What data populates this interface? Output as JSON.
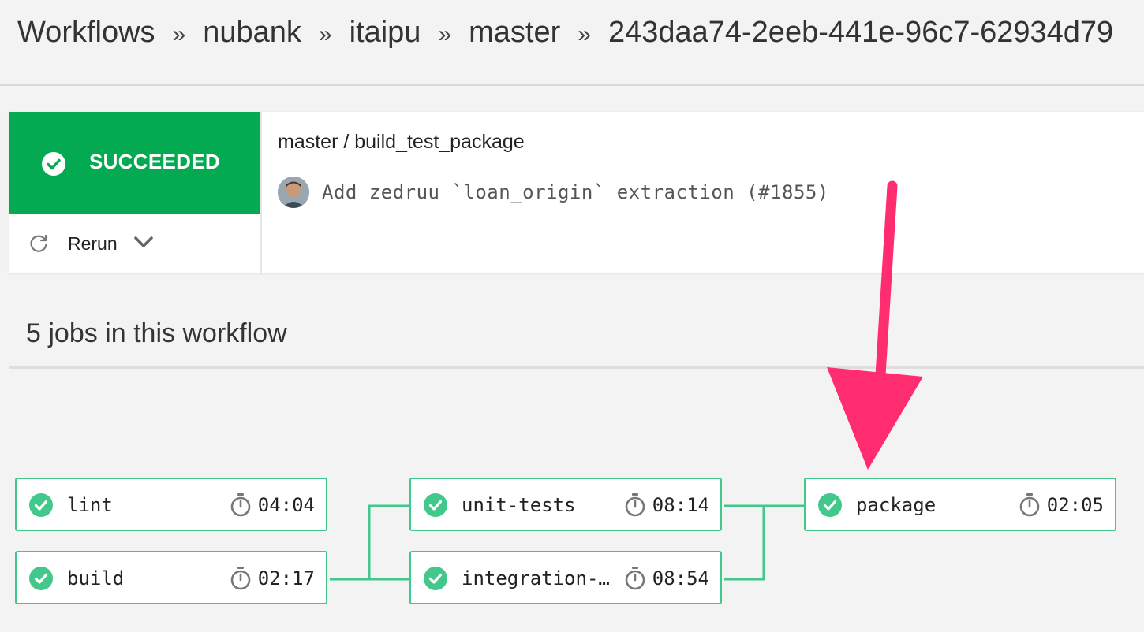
{
  "breadcrumb": {
    "items": [
      "Workflows",
      "nubank",
      "itaipu",
      "master",
      "243daa74-2eeb-441e-96c7-62934d79"
    ],
    "separator": "»"
  },
  "summary": {
    "status": "SUCCEEDED",
    "status_color": "#04aa51",
    "rerun_label": "Rerun",
    "workflow_title": "master / build_test_package",
    "commit_message": "Add zedruu `loan_origin` extraction (#1855)"
  },
  "jobs_section": {
    "heading": "5 jobs in this workflow",
    "accent_color": "#42c88a",
    "jobs": [
      {
        "name": "lint",
        "duration": "04:04"
      },
      {
        "name": "build",
        "duration": "02:17"
      },
      {
        "name": "unit-tests",
        "duration": "08:14"
      },
      {
        "name": "integration-…",
        "duration": "08:54"
      },
      {
        "name": "package",
        "duration": "02:05"
      }
    ]
  },
  "annotation": {
    "arrow_color": "#ff2d6f"
  },
  "icons": {
    "status": "check-circle-icon",
    "rerun": "refresh-icon",
    "menu": "chevron-down-icon",
    "timer": "stopwatch-icon"
  }
}
